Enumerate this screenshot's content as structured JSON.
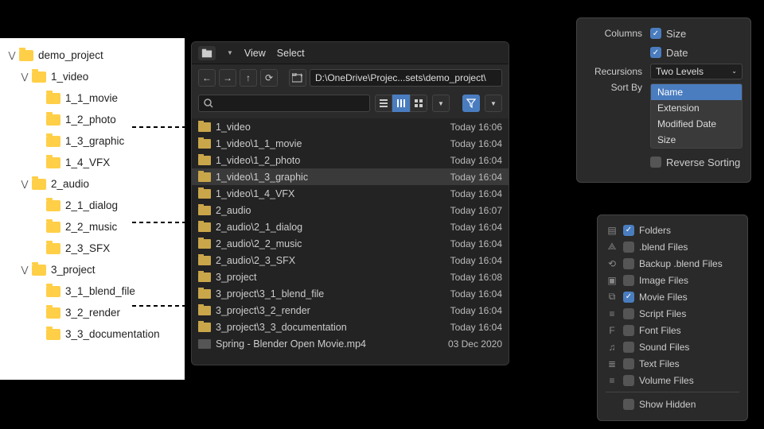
{
  "tree": {
    "root": "demo_project",
    "nodes": [
      {
        "label": "1_video",
        "children": [
          "1_1_movie",
          "1_2_photo",
          "1_3_graphic",
          "1_4_VFX"
        ]
      },
      {
        "label": "2_audio",
        "children": [
          "2_1_dialog",
          "2_2_music",
          "2_3_SFX"
        ]
      },
      {
        "label": "3_project",
        "children": [
          "3_1_blend_file",
          "3_2_render",
          "3_3_documentation"
        ]
      }
    ]
  },
  "browser": {
    "menu": {
      "view": "View",
      "select": "Select"
    },
    "path": "D:\\OneDrive\\Projec...sets\\demo_project\\",
    "files": [
      {
        "name": "1_video",
        "date": "Today 16:06",
        "type": "folder"
      },
      {
        "name": "1_video\\1_1_movie",
        "date": "Today 16:04",
        "type": "folder"
      },
      {
        "name": "1_video\\1_2_photo",
        "date": "Today 16:04",
        "type": "folder"
      },
      {
        "name": "1_video\\1_3_graphic",
        "date": "Today 16:04",
        "type": "folder",
        "selected": true
      },
      {
        "name": "1_video\\1_4_VFX",
        "date": "Today 16:04",
        "type": "folder"
      },
      {
        "name": "2_audio",
        "date": "Today 16:07",
        "type": "folder"
      },
      {
        "name": "2_audio\\2_1_dialog",
        "date": "Today 16:04",
        "type": "folder"
      },
      {
        "name": "2_audio\\2_2_music",
        "date": "Today 16:04",
        "type": "folder"
      },
      {
        "name": "2_audio\\2_3_SFX",
        "date": "Today 16:04",
        "type": "folder"
      },
      {
        "name": "3_project",
        "date": "Today 16:08",
        "type": "folder"
      },
      {
        "name": "3_project\\3_1_blend_file",
        "date": "Today 16:04",
        "type": "folder"
      },
      {
        "name": "3_project\\3_2_render",
        "date": "Today 16:04",
        "type": "folder"
      },
      {
        "name": "3_project\\3_3_documentation",
        "date": "Today 16:04",
        "type": "folder"
      },
      {
        "name": "Spring - Blender Open Movie.mp4",
        "date": "03 Dec 2020",
        "type": "movie"
      }
    ]
  },
  "settings": {
    "columns_label": "Columns",
    "size_label": "Size",
    "date_label": "Date",
    "recursions_label": "Recursions",
    "recursions_value": "Two Levels",
    "sortby_label": "Sort By",
    "sort_options": [
      "Name",
      "Extension",
      "Modified Date",
      "Size"
    ],
    "sort_selected": "Name",
    "reverse_label": "Reverse Sorting"
  },
  "filters": {
    "items": [
      {
        "icon": "folder",
        "label": "Folders",
        "on": true
      },
      {
        "icon": "blender",
        "label": ".blend Files",
        "on": false
      },
      {
        "icon": "backup",
        "label": "Backup .blend Files",
        "on": false
      },
      {
        "icon": "image",
        "label": "Image Files",
        "on": false
      },
      {
        "icon": "movie",
        "label": "Movie Files",
        "on": true
      },
      {
        "icon": "script",
        "label": "Script Files",
        "on": false
      },
      {
        "icon": "font",
        "label": "Font Files",
        "on": false
      },
      {
        "icon": "sound",
        "label": "Sound Files",
        "on": false
      },
      {
        "icon": "text",
        "label": "Text Files",
        "on": false
      },
      {
        "icon": "volume",
        "label": "Volume Files",
        "on": false
      }
    ],
    "show_hidden_label": "Show Hidden"
  }
}
